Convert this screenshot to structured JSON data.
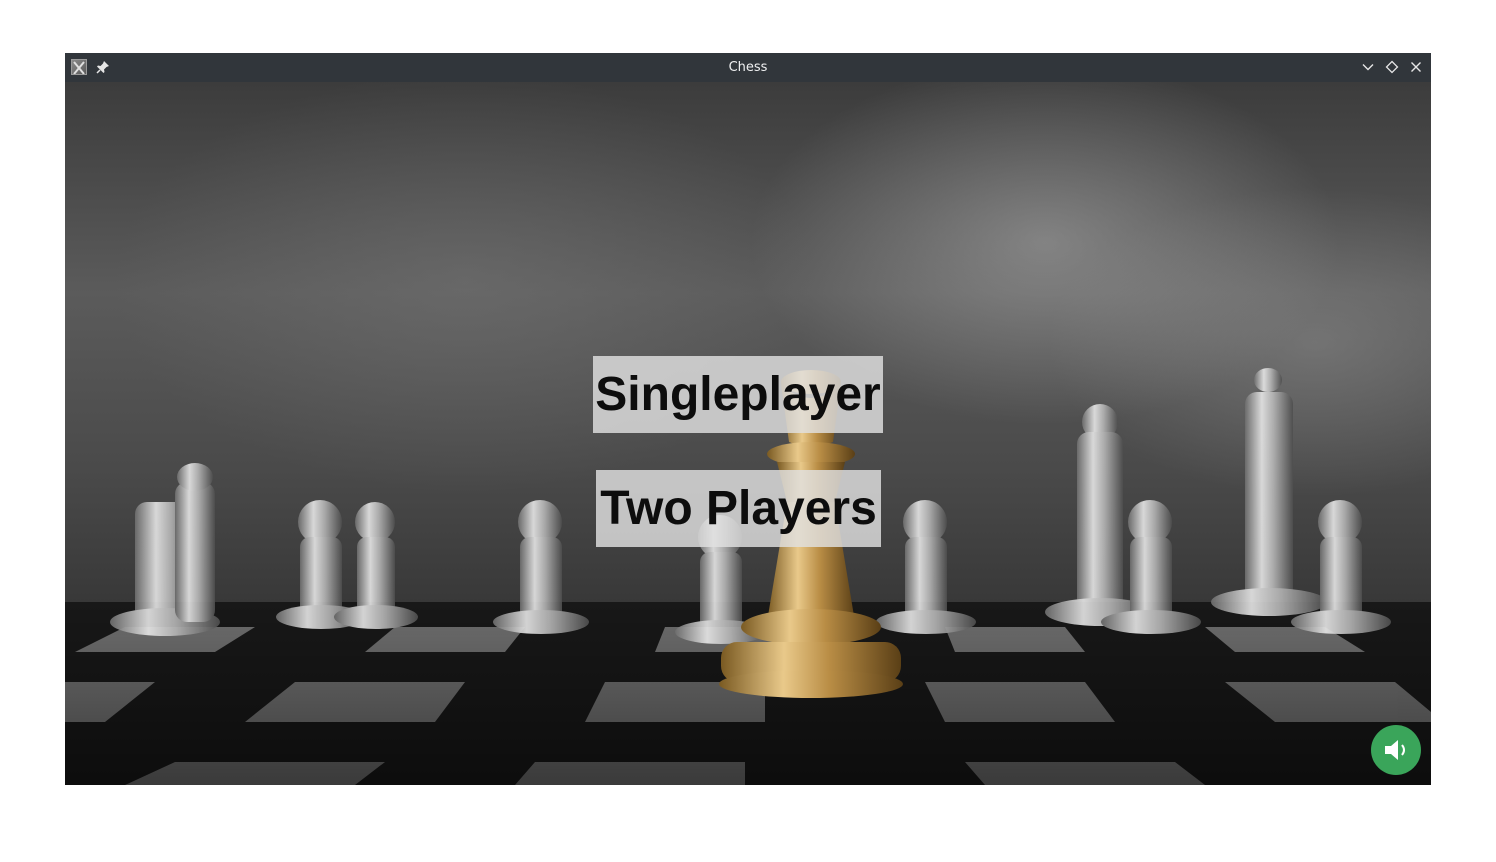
{
  "window": {
    "title": "Chess"
  },
  "menu": {
    "singleplayer_label": "Singleplayer",
    "two_players_label": "Two Players"
  },
  "icons": {
    "app": "x-app-icon",
    "pin": "pin-icon",
    "minimize": "chevron-down-icon",
    "maximize": "diamond-icon",
    "close": "close-icon",
    "sound": "speaker-icon"
  },
  "colors": {
    "titlebar": "#31363b",
    "titlebar_text": "#eff0f1",
    "button_bg": "#e1e1e1",
    "button_text": "#0d0d0d",
    "sound_button": "#3aa55a"
  }
}
